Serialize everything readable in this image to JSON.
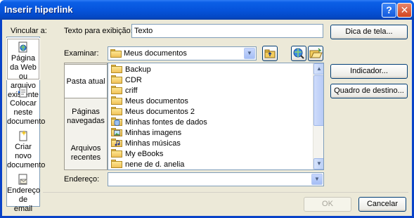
{
  "window": {
    "title": "Inserir hiperlink",
    "help_label": "?",
    "close_label": "✕"
  },
  "vincular": {
    "label": "Vincular a:",
    "items": [
      {
        "line1": "Página da Web",
        "line2": "ou arquivo",
        "line3": "existente",
        "icon": "web-page-icon",
        "selected": true
      },
      {
        "line1": "Colocar neste",
        "line2": "documento",
        "line3": "",
        "icon": "document-place-icon",
        "selected": false
      },
      {
        "line1": "Criar novo",
        "line2": "documento",
        "line3": "",
        "icon": "new-document-icon",
        "selected": false
      },
      {
        "line1": "Endereço de",
        "line2": "email",
        "line3": "",
        "icon": "email-icon",
        "selected": false
      }
    ]
  },
  "texto": {
    "label": "Texto para exibição:",
    "value": "Texto"
  },
  "dica_button": "Dica de tela...",
  "examinar": {
    "label": "Examinar:",
    "value": "Meus documentos"
  },
  "tabs": [
    {
      "line1": "Pasta atual",
      "line2": "",
      "selected": true
    },
    {
      "line1": "Páginas",
      "line2": "navegadas",
      "selected": false
    },
    {
      "line1": "Arquivos",
      "line2": "recentes",
      "selected": false
    }
  ],
  "files": [
    {
      "name": "Backup",
      "icon": "folder-icon"
    },
    {
      "name": "CDR",
      "icon": "folder-icon"
    },
    {
      "name": "criff",
      "icon": "folder-icon"
    },
    {
      "name": "Meus documentos",
      "icon": "folder-icon"
    },
    {
      "name": "Meus documentos 2",
      "icon": "folder-icon"
    },
    {
      "name": "Minhas fontes de dados",
      "icon": "data-sources-folder-icon"
    },
    {
      "name": "Minhas imagens",
      "icon": "pictures-folder-icon"
    },
    {
      "name": "Minhas músicas",
      "icon": "music-folder-icon"
    },
    {
      "name": "My eBooks",
      "icon": "folder-icon"
    },
    {
      "name": "nene de d. anelia",
      "icon": "folder-icon"
    }
  ],
  "indicador_button": "Indicador...",
  "quadro_button": "Quadro de destino...",
  "endereco": {
    "label": "Endereço:",
    "value": ""
  },
  "ok_button": "OK",
  "cancel_button": "Cancelar"
}
